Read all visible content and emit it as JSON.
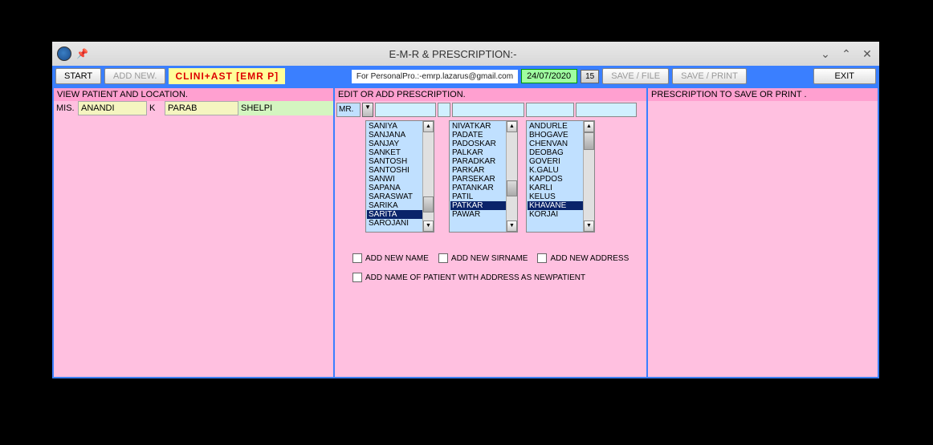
{
  "window": {
    "title": "E-M-R & PRESCRIPTION:-"
  },
  "toolbar": {
    "start": "START",
    "add_new": "ADD NEW.",
    "brand": "CLINI+AST [EMR P]",
    "email": "For PersonalPro.:-emrp.lazarus@gmail.com",
    "date": "24/07/2020",
    "date_day": "15",
    "save_file": "SAVE / FILE",
    "save_print": "SAVE / PRINT",
    "exit": "EXIT"
  },
  "left_panel": {
    "header": "VIEW PATIENT AND LOCATION.",
    "title": "MIS.",
    "first": "ANANDI",
    "mid": "K",
    "last": "PARAB",
    "loc": "SHELPI"
  },
  "mid_panel": {
    "header": "EDIT OR ADD PRESCRIPTION.",
    "title_combo": "MR.",
    "list1": [
      "SANIYA",
      "SANJANA",
      "SANJAY",
      "SANKET",
      "SANTOSH",
      "SANTOSHI",
      "SANWI",
      "SAPANA",
      "SARASWAT",
      "SARIKA",
      "SARITA",
      "SAROJANI"
    ],
    "list1_selected": "SARITA",
    "list2": [
      "NIVATKAR",
      "PADATE",
      "PADOSKAR",
      "PALKAR",
      "PARADKAR",
      "PARKAR",
      "PARSEKAR",
      "PATANKAR",
      "PATIL",
      "PATKAR",
      "PAWAR"
    ],
    "list2_selected": "PATKAR",
    "list3": [
      "ANDURLE",
      "BHOGAVE",
      "CHENVAN",
      "DEOBAG",
      "GOVERI",
      "K.GALU",
      "KAPDOS",
      "KARLI",
      "KELUS",
      "KHAVANE",
      "KORJAI"
    ],
    "list3_selected": "KHAVANE",
    "chk_name": "ADD  NEW NAME",
    "chk_sirname": "ADD NEW SIRNAME",
    "chk_address": "ADD NEW ADDRESS",
    "chk_patient": "ADD NAME OF PATIENT WITH ADDRESS   AS NEWPATIENT"
  },
  "right_panel": {
    "header": "PRESCRIPTION TO SAVE OR PRINT ."
  }
}
